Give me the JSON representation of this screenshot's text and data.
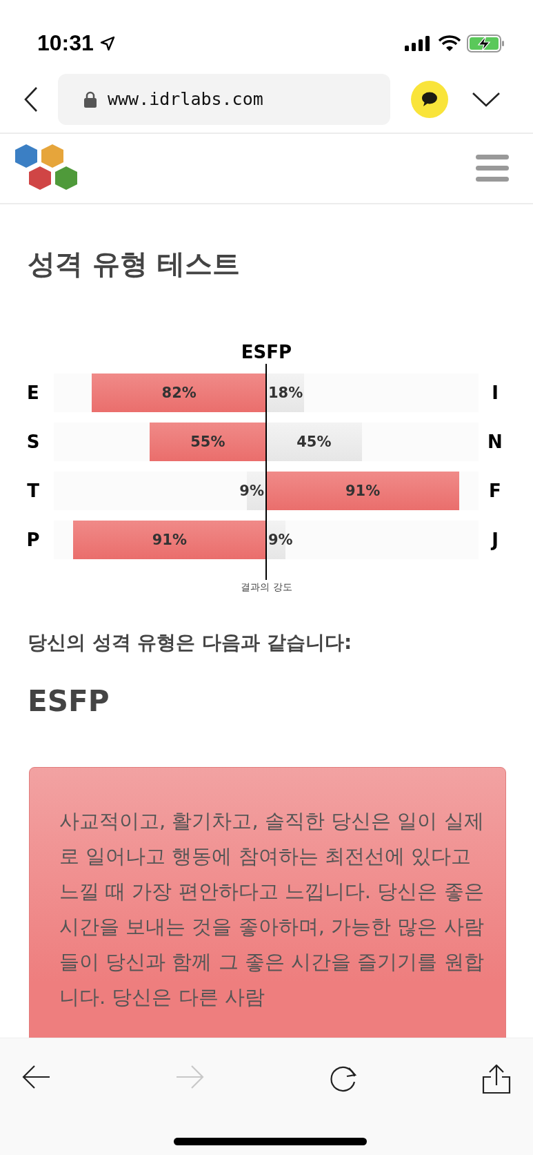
{
  "status_bar": {
    "time": "10:31"
  },
  "browser": {
    "url": "www.idrlabs.com"
  },
  "page": {
    "title": "성격 유형 테스트",
    "scale": {
      "title": "ESFP",
      "caption": "결과의 강도",
      "rows": [
        {
          "left": {
            "letter": "E",
            "reading": "82%",
            "level": 0.82
          },
          "right": {
            "letter": "I",
            "reading": "18%",
            "level": 0.18
          }
        },
        {
          "left": {
            "letter": "S",
            "reading": "55%",
            "level": 0.55
          },
          "right": {
            "letter": "N",
            "reading": "45%",
            "level": 0.45
          }
        },
        {
          "left": {
            "letter": "T",
            "reading": "9%",
            "level": 0.09
          },
          "right": {
            "letter": "F",
            "reading": "91%",
            "level": 0.91
          }
        },
        {
          "left": {
            "letter": "P",
            "reading": "91%",
            "level": 0.91
          },
          "right": {
            "letter": "J",
            "reading": "9%",
            "level": 0.09
          }
        }
      ]
    },
    "result_heading": "당신의 성격 유형은 다음과 같습니다:",
    "result_type": "ESFP",
    "description": "사교적이고, 활기차고, 솔직한 당신은 일이 실제로 일어나고 행동에 참여하는 최전선에 있다고 느낄 때 가장 편안하다고 느낍니다. 당신은 좋은 시간을 보내는 것을 좋아하며, 가능한 많은 사람들이 당신과 함께 그 좋은 시간을 즐기기를 원합니다. 당신은 다른 사람"
  },
  "toolbar": {
    "forward_disabled": true
  }
}
